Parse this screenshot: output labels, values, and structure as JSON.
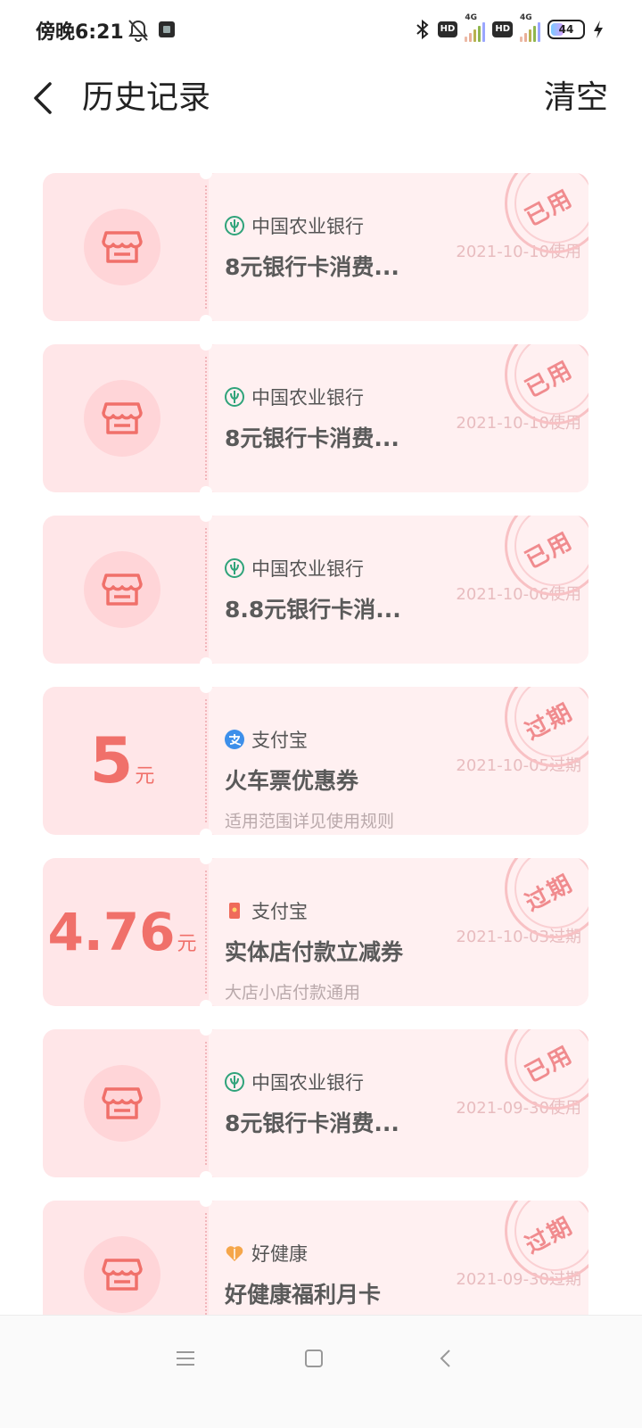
{
  "status_bar": {
    "time": "傍晚6:21",
    "battery": "44",
    "hd_label": "HD",
    "network_label": "4G"
  },
  "header": {
    "title": "历史记录",
    "clear_label": "清空"
  },
  "coupons": [
    {
      "issuer": "中国农业银行",
      "issuer_icon": "abc-bank-icon",
      "name": "8元银行卡消费...",
      "desc": "",
      "date": "2021-10-10使用",
      "stamp": "已用",
      "left_type": "shop"
    },
    {
      "issuer": "中国农业银行",
      "issuer_icon": "abc-bank-icon",
      "name": "8元银行卡消费...",
      "desc": "",
      "date": "2021-10-10使用",
      "stamp": "已用",
      "left_type": "shop"
    },
    {
      "issuer": "中国农业银行",
      "issuer_icon": "abc-bank-icon",
      "name": "8.8元银行卡消...",
      "desc": "",
      "date": "2021-10-06使用",
      "stamp": "已用",
      "left_type": "shop"
    },
    {
      "issuer": "支付宝",
      "issuer_icon": "alipay-icon",
      "name": "火车票优惠券",
      "desc": "适用范围详见使用规则",
      "date": "2021-10-05过期",
      "stamp": "过期",
      "left_type": "amount",
      "amount": "5",
      "unit": "元"
    },
    {
      "issuer": "支付宝",
      "issuer_icon": "red-packet-icon",
      "name": "实体店付款立减券",
      "desc": "大店小店付款通用",
      "date": "2021-10-03过期",
      "stamp": "过期",
      "left_type": "amount",
      "amount": "4.76",
      "unit": "元"
    },
    {
      "issuer": "中国农业银行",
      "issuer_icon": "abc-bank-icon",
      "name": "8元银行卡消费...",
      "desc": "",
      "date": "2021-09-30使用",
      "stamp": "已用",
      "left_type": "shop"
    },
    {
      "issuer": "好健康",
      "issuer_icon": "heart-icon",
      "name": "好健康福利月卡",
      "desc": "",
      "date": "2021-09-30过期",
      "stamp": "过期",
      "left_type": "shop"
    }
  ],
  "colors": {
    "accent": "#f0706a",
    "card_bg": "#ffe6e8",
    "abc_green": "#2fa37a",
    "alipay_blue": "#3d8fea"
  }
}
